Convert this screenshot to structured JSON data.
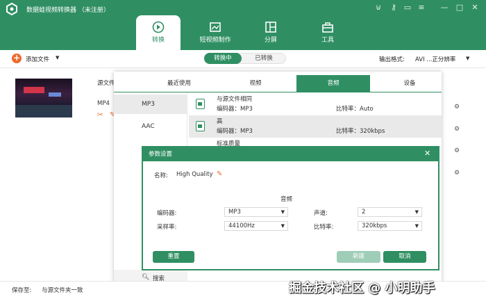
{
  "app": {
    "title": "数据蛙视频转换器 （未注册）",
    "accent": "#2f8f63",
    "orange": "#ee6a2b"
  },
  "nav": {
    "tabs": [
      {
        "label": "转换"
      },
      {
        "label": "短视频制作"
      },
      {
        "label": "分屏"
      },
      {
        "label": "工具"
      }
    ]
  },
  "toolbar": {
    "add_file": "添加文件",
    "converting": "转换中",
    "converted": "已转换",
    "output_format_label": "输出格式:",
    "output_format_value": "AVI ...正分辨率"
  },
  "file": {
    "source_label": "源文件",
    "format": "MP4"
  },
  "format_panel": {
    "tabs": [
      "最近使用",
      "视频",
      "音频",
      "设备"
    ],
    "formats": [
      "MP3",
      "AAC"
    ],
    "presets": [
      {
        "name": "与源文件相同",
        "encoder": "编码器：MP3",
        "bitrate": "比特率：Auto"
      },
      {
        "name": "高",
        "encoder": "编码器：MP3",
        "bitrate": "比特率：320kbps"
      },
      {
        "name": "标准质量"
      }
    ],
    "search": "搜索"
  },
  "dialog": {
    "title": "参数设置",
    "name_label": "名称:",
    "name_value": "High Quality",
    "section": "音频",
    "encoder_label": "编码器:",
    "encoder_value": "MP3",
    "samplerate_label": "采样率:",
    "samplerate_value": "44100Hz",
    "channel_label": "声道:",
    "channel_value": "2",
    "bitrate_label": "比特率:",
    "bitrate_value": "320kbps",
    "reset": "重置",
    "new": "新建",
    "cancel": "取消"
  },
  "bottom": {
    "save_label": "保存至:",
    "save_value": "与源文件夹一致"
  },
  "watermark": "掘金技术社区 @ 小明助手"
}
